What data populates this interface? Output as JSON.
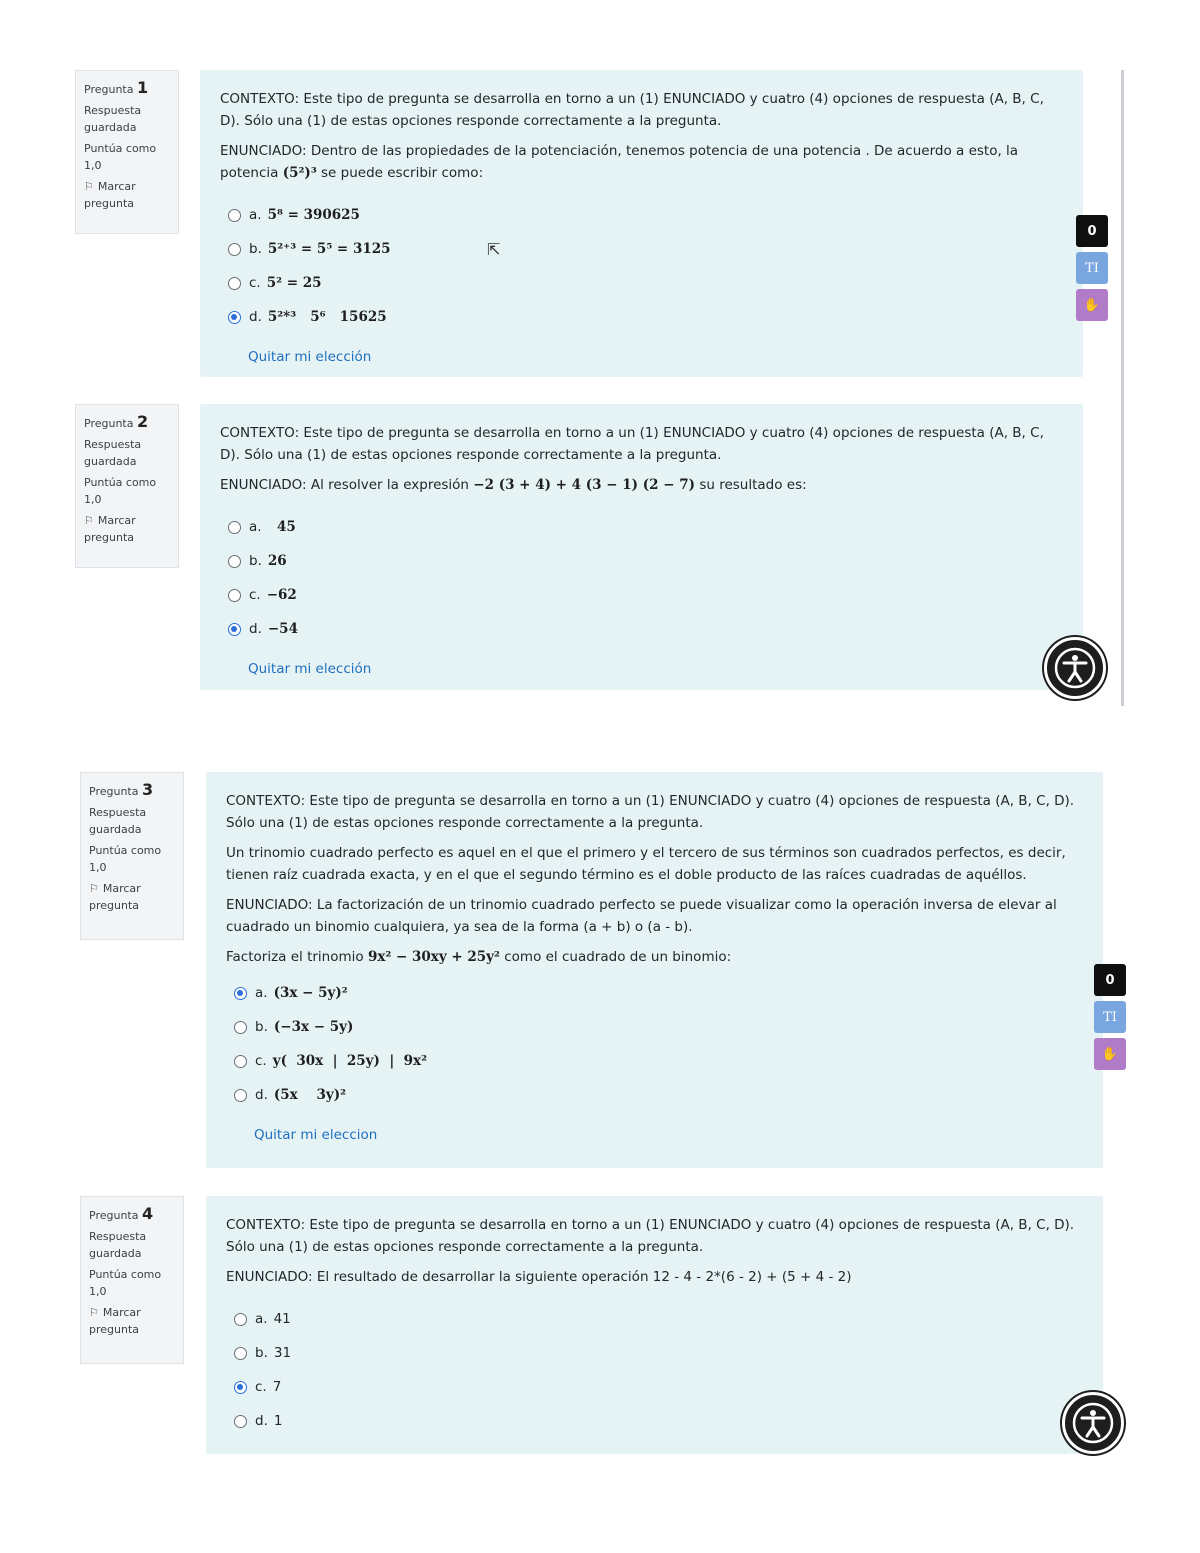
{
  "common": {
    "context": "CONTEXTO: Este tipo de pregunta se desarrolla en torno a un (1) ENUNCIADO y cuatro (4) opciones de respuesta (A, B, C, D). Sólo una (1) de estas opciones responde correctamente a la pregunta.",
    "clear_choice": "Quitar mi elección",
    "clear_choice_alt": "Quitar mi eleccion",
    "status": "Respuesta guardada",
    "flag": "Marcar pregunta"
  },
  "questions": [
    {
      "label": "Pregunta",
      "number": "1",
      "score": "Puntúa como 1,0",
      "statement_a": "ENUNCIADO: Dentro de las propiedades de la potenciación, tenemos potencia de una potencia . De acuerdo a esto, la potencia ",
      "statement_math": "(5²)³",
      "statement_b": " se puede escribir como:",
      "options": [
        {
          "letter": "a.",
          "text": "5⁸ = 390625",
          "checked": false
        },
        {
          "letter": "b.",
          "text": "5²⁺³ = 5⁵ = 3125",
          "checked": false
        },
        {
          "letter": "c.",
          "text": "5² = 25",
          "checked": false
        },
        {
          "letter": "d.",
          "text": "5²*³   5⁶   15625",
          "checked": true
        }
      ]
    },
    {
      "label": "Pregunta",
      "number": "2",
      "score": "Puntúa como 1,0",
      "statement_a": "ENUNCIADO: Al resolver la expresión ",
      "statement_math": "−2 (3 + 4) + 4 (3 − 1) (2 − 7)",
      "statement_b": " su resultado es:",
      "options": [
        {
          "letter": "a.",
          "text": "  45",
          "checked": false
        },
        {
          "letter": "b.",
          "text": "26",
          "checked": false
        },
        {
          "letter": "c.",
          "text": "−62",
          "checked": false
        },
        {
          "letter": "d.",
          "text": "−54",
          "checked": true
        }
      ]
    },
    {
      "label": "Pregunta",
      "number": "3",
      "score": "Puntúa como 1,0",
      "paragraph": "Un trinomio cuadrado perfecto es aquel en el que el primero y el tercero de sus términos son cuadrados perfectos, es decir, tienen raíz cuadrada exacta, y en el que el segundo término es el doble producto de las raíces cuadradas de aquéllos.",
      "statement": "ENUNCIADO: La factorización de un trinomio cuadrado perfecto se puede visualizar como la operación inversa de elevar al cuadrado un binomio cualquiera, ya sea de la forma (a + b) o (a - b).",
      "statement_a": "Factoriza el trinomio ",
      "statement_math": "9x² − 30xy + 25y²",
      "statement_b": " como el cuadrado de un binomio:",
      "options": [
        {
          "letter": "a.",
          "text": "(3x − 5y)²",
          "checked": true
        },
        {
          "letter": "b.",
          "text": "(−3x − 5y)",
          "checked": false
        },
        {
          "letter": "c.",
          "text": "y(  30x  |  25y)  |  9x²",
          "checked": false
        },
        {
          "letter": "d.",
          "text": "(5x    3y)²",
          "checked": false
        }
      ]
    },
    {
      "label": "Pregunta",
      "number": "4",
      "score": "Puntúa como 1,0",
      "statement_a": "ENUNCIADO: El resultado de desarrollar la siguiente operación 12 - 4 - 2*(6 - 2) + (5 + 4 - 2)",
      "options": [
        {
          "letter": "a.",
          "text": "41",
          "checked": false
        },
        {
          "letter": "b.",
          "text": "31",
          "checked": false
        },
        {
          "letter": "c.",
          "text": "7",
          "checked": true
        },
        {
          "letter": "d.",
          "text": "1",
          "checked": false
        }
      ]
    }
  ],
  "widgets": {
    "badge": "0",
    "translate": "TI"
  },
  "colors": {
    "card": "#e6f3f5",
    "link": "#1f6fbf",
    "radio_checked": "#2a6fdb"
  }
}
